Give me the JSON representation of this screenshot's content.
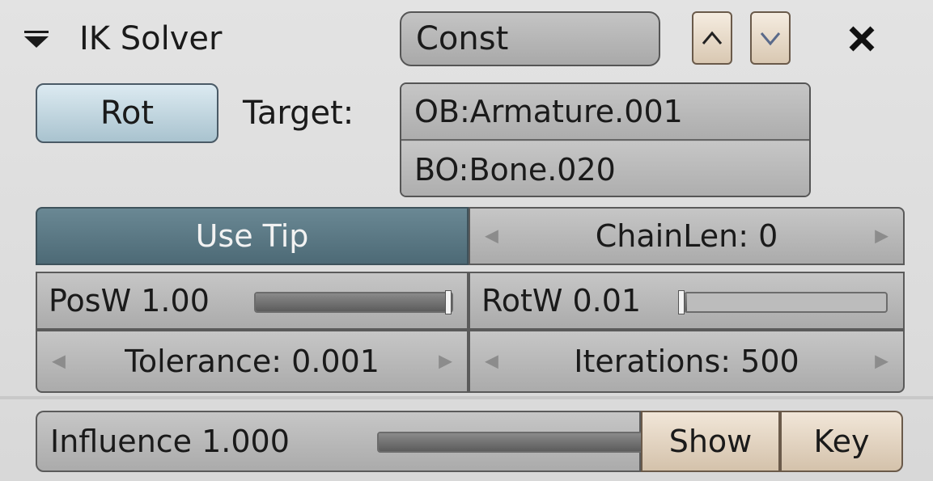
{
  "constraint": {
    "title": "IK Solver",
    "type_value": "Const",
    "move_up_glyph": "^",
    "move_down_glyph": "v",
    "close_glyph": "X"
  },
  "rot_button": {
    "label": "Rot"
  },
  "target": {
    "label": "Target:",
    "object_value": "OB:Armature.001",
    "bone_value": "BO:Bone.020"
  },
  "settings": {
    "use_tip": {
      "label": "Use Tip",
      "active": true
    },
    "chain_len": {
      "label": "ChainLen: 0",
      "value": 0
    },
    "pos_weight": {
      "label": "PosW 1.00",
      "value": 1.0
    },
    "rot_weight": {
      "label": "RotW 0.01",
      "value": 0.01
    },
    "tolerance": {
      "label": "Tolerance: 0.001",
      "value": 0.001
    },
    "iterations": {
      "label": "Iterations: 500",
      "value": 500
    }
  },
  "influence": {
    "label": "Influence 1.000",
    "value": 1.0
  },
  "show_button": {
    "label": "Show"
  },
  "key_button": {
    "label": "Key"
  },
  "icons": {
    "collapse": "triangle-down-icon",
    "up": "chevron-up-icon",
    "down": "chevron-down-icon",
    "close": "close-icon",
    "decrement": "arrow-left-icon",
    "increment": "arrow-right-icon"
  },
  "colors": {
    "use_tip_active": "#56737f",
    "rot_button": "#b8d0db",
    "move_buttons": "#e6d6c3"
  }
}
